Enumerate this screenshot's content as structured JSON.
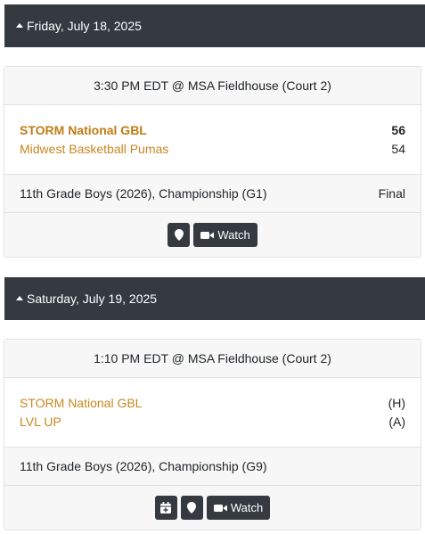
{
  "days": [
    {
      "date": "Friday, July 18, 2025",
      "game": {
        "time_location": "3:30 PM EDT @ MSA Fieldhouse (Court 2)",
        "teams": [
          {
            "name": "STORM National GBL",
            "score": "56"
          },
          {
            "name": "Midwest Basketball Pumas",
            "score": "54"
          }
        ],
        "division": "11th Grade Boys (2026), Championship (G1)",
        "status": "Final",
        "watch_label": "Watch"
      }
    },
    {
      "date": "Saturday, July 19, 2025",
      "game": {
        "time_location": "1:10 PM EDT @ MSA Fieldhouse (Court 2)",
        "teams": [
          {
            "name": "STORM National GBL",
            "score": "(H)"
          },
          {
            "name": "LVL UP",
            "score": "(A)"
          }
        ],
        "division": "11th Grade Boys (2026), Championship (G9)",
        "status": "",
        "watch_label": "Watch"
      }
    }
  ],
  "icons": {
    "caret": "caret-up-icon",
    "location": "map-marker-icon",
    "video": "video-camera-icon",
    "calendar": "calendar-plus-icon"
  },
  "colors": {
    "header_bg": "#343a40",
    "team_link": "#c8871f",
    "button_bg": "#343a40"
  }
}
